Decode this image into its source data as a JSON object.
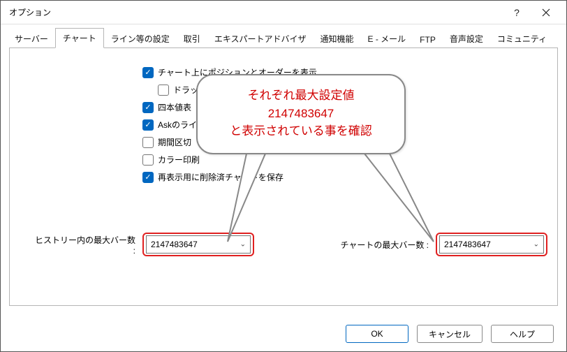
{
  "window": {
    "title": "オプション"
  },
  "tabs": [
    "サーバー",
    "チャート",
    "ライン等の設定",
    "取引",
    "エキスパートアドバイザ",
    "通知機能",
    "E - メール",
    "FTP",
    "音声設定",
    "コミュニティ"
  ],
  "active_tab": "チャート",
  "checks": {
    "show_positions": {
      "label": "チャート上にポジションとオーダーを表示",
      "checked": true
    },
    "drag_alt": {
      "label": "ドラッグによる取引変更に'Alt' キーを使う",
      "checked": false
    },
    "ohlc": {
      "label": "四本値表",
      "checked": true
    },
    "askline": {
      "label": "Askのライ",
      "checked": true
    },
    "period_sep": {
      "label": "期間区切",
      "checked": false
    },
    "color_print": {
      "label": "カラー印刷",
      "checked": false
    },
    "save_deleted": {
      "label": "再表示用に削除済チャートを保存",
      "checked": true
    }
  },
  "fields": {
    "history_bars": {
      "label": "ヒストリー内の最大バー数 :",
      "value": "2147483647"
    },
    "chart_bars": {
      "label": "チャートの最大バー数 :",
      "value": "2147483647"
    }
  },
  "callout": {
    "line1": "それぞれ最大設定値",
    "line2": "2147483647",
    "line3": "と表示されている事を確認"
  },
  "buttons": {
    "ok": "OK",
    "cancel": "キャンセル",
    "help": "ヘルプ"
  }
}
